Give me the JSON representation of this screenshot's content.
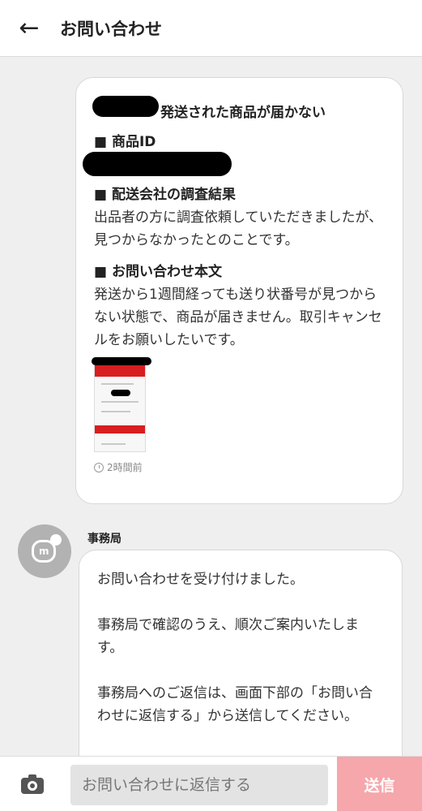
{
  "header": {
    "back_icon": "arrow-left-icon",
    "back_glyph": "←",
    "title": "お問い合わせ"
  },
  "inquiry": {
    "subject": "発送された商品が届かない",
    "sections": [
      {
        "heading": "■ 商品ID",
        "body": ""
      },
      {
        "heading": "■ 配送会社の調査結果",
        "body": "出品者の方に調査依頼していただきましたが、見つからなかったとのことです。"
      },
      {
        "heading": "■ お問い合わせ本文",
        "body": "発送から1週間経っても送り状番号が見つからない状態で、商品が届きません。取引キャンセルをお願いしたいです。"
      }
    ],
    "timestamp": "2時間前"
  },
  "office": {
    "sender": "事務局",
    "avatar_letter": "m",
    "paragraphs": [
      "お問い合わせを受け付けました。",
      "事務局で確認のうえ、順次ご案内いたします。",
      "事務局へのご返信は、画面下部の「お問い合わせに返信する」から送信してください。"
    ]
  },
  "footer": {
    "camera_icon": "camera-icon",
    "reply_placeholder": "お問い合わせに返信する",
    "send_label": "送信"
  },
  "colors": {
    "accent_send": "#f5a7ab",
    "brand_red": "#d81e1e",
    "background": "#efefef"
  }
}
